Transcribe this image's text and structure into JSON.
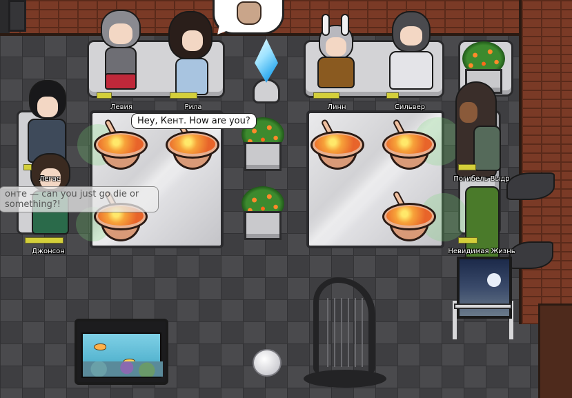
{
  "scene": {
    "type": "game-room",
    "theme_colors": {
      "brick": "#7a3a26",
      "floor": "#4a4a4d",
      "name_bar": "#d4cf3a",
      "bubble": "#ffffff"
    }
  },
  "characters": [
    {
      "id": "leviya",
      "name": "Левия"
    },
    {
      "id": "rila",
      "name": "Рила"
    },
    {
      "id": "linn",
      "name": "Линн"
    },
    {
      "id": "silver",
      "name": "Сильвер"
    },
    {
      "id": "legas",
      "name": "Легас"
    },
    {
      "id": "pogibel",
      "name": "Погибель Выдр"
    },
    {
      "id": "johnson",
      "name": "Джонсон"
    },
    {
      "id": "nevidimaya",
      "name": "Невидимая Жизнь"
    }
  ],
  "speech": {
    "main": "Hey, Кент. How are you?",
    "faded_line1": "онте — can you just go die or",
    "faded_line2": "something?!"
  },
  "objects": {
    "emote": "hand-wave-icon",
    "icons": [
      "crystal-icon",
      "harp-icon",
      "aquarium-icon",
      "painting-icon",
      "ball-icon",
      "bowl-icon",
      "planter-icon"
    ]
  }
}
